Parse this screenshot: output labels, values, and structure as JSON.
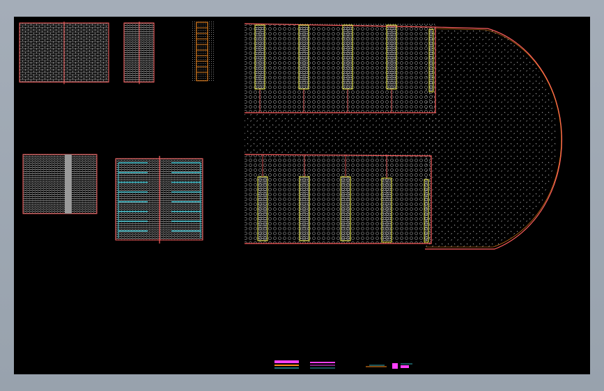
{
  "canvas": {
    "background": "#000000",
    "window_background": "#9ea7b2"
  },
  "palette": {
    "outline": "#ff5e5e",
    "hatch": "#c8c8c8",
    "strip": "#e8e83a",
    "accent": "#ff8c1a",
    "cyan": "#3fe0f0",
    "magenta": "#ff40ff",
    "grey_band": "#9a9a9a"
  }
}
